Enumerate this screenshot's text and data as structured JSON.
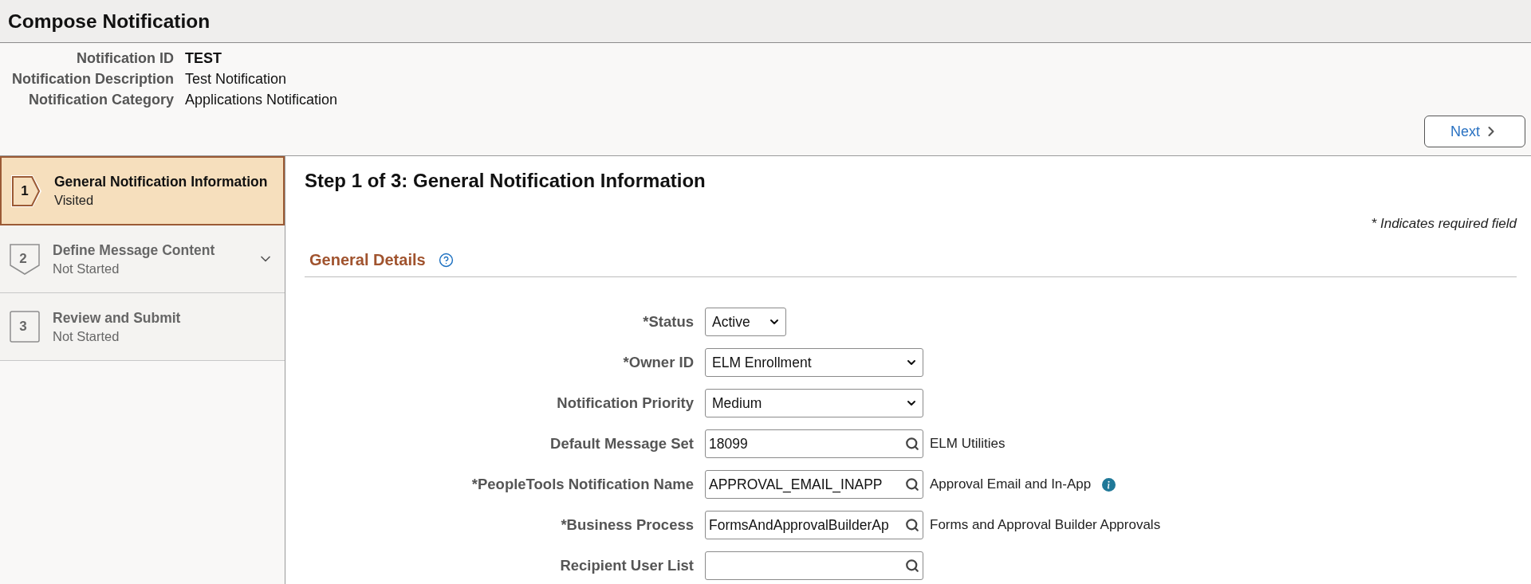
{
  "page": {
    "title": "Compose Notification"
  },
  "summary": [
    {
      "label": "Notification ID",
      "value": "TEST",
      "bold": true
    },
    {
      "label": "Notification Description",
      "value": "Test Notification",
      "bold": false
    },
    {
      "label": "Notification Category",
      "value": "Applications Notification",
      "bold": false
    }
  ],
  "next_button": {
    "label": "Next"
  },
  "steps": [
    {
      "number": "1",
      "title": "General Notification Information",
      "status": "Visited",
      "selected": true,
      "kind": "arrow",
      "expandable": false
    },
    {
      "number": "2",
      "title": "Define Message Content",
      "status": "Not Started",
      "selected": false,
      "kind": "down",
      "expandable": true
    },
    {
      "number": "3",
      "title": "Review and Submit",
      "status": "Not Started",
      "selected": false,
      "kind": "square",
      "expandable": false
    }
  ],
  "step_title": "Step 1 of 3: General Notification Information",
  "required_note": "* Indicates required field",
  "section": {
    "title": "General Details"
  },
  "fields": [
    {
      "label": "*Status",
      "kind": "compact",
      "value": "Active"
    },
    {
      "label": "*Owner ID",
      "kind": "select",
      "value": "ELM Enrollment"
    },
    {
      "label": "Notification Priority",
      "kind": "select",
      "value": "Medium"
    },
    {
      "label": "Default Message Set",
      "kind": "prompt",
      "value": "18099",
      "description": "ELM Utilities"
    },
    {
      "label": "*PeopleTools Notification Name",
      "kind": "prompt",
      "value": "APPROVAL_EMAIL_INAPP",
      "description": "Approval Email and In-App",
      "info": true
    },
    {
      "label": "*Business Process",
      "kind": "prompt",
      "value": "FormsAndApprovalBuilderAp",
      "description": "Forms and Approval Builder Approvals"
    },
    {
      "label": "Recipient User List",
      "kind": "prompt"
    }
  ]
}
